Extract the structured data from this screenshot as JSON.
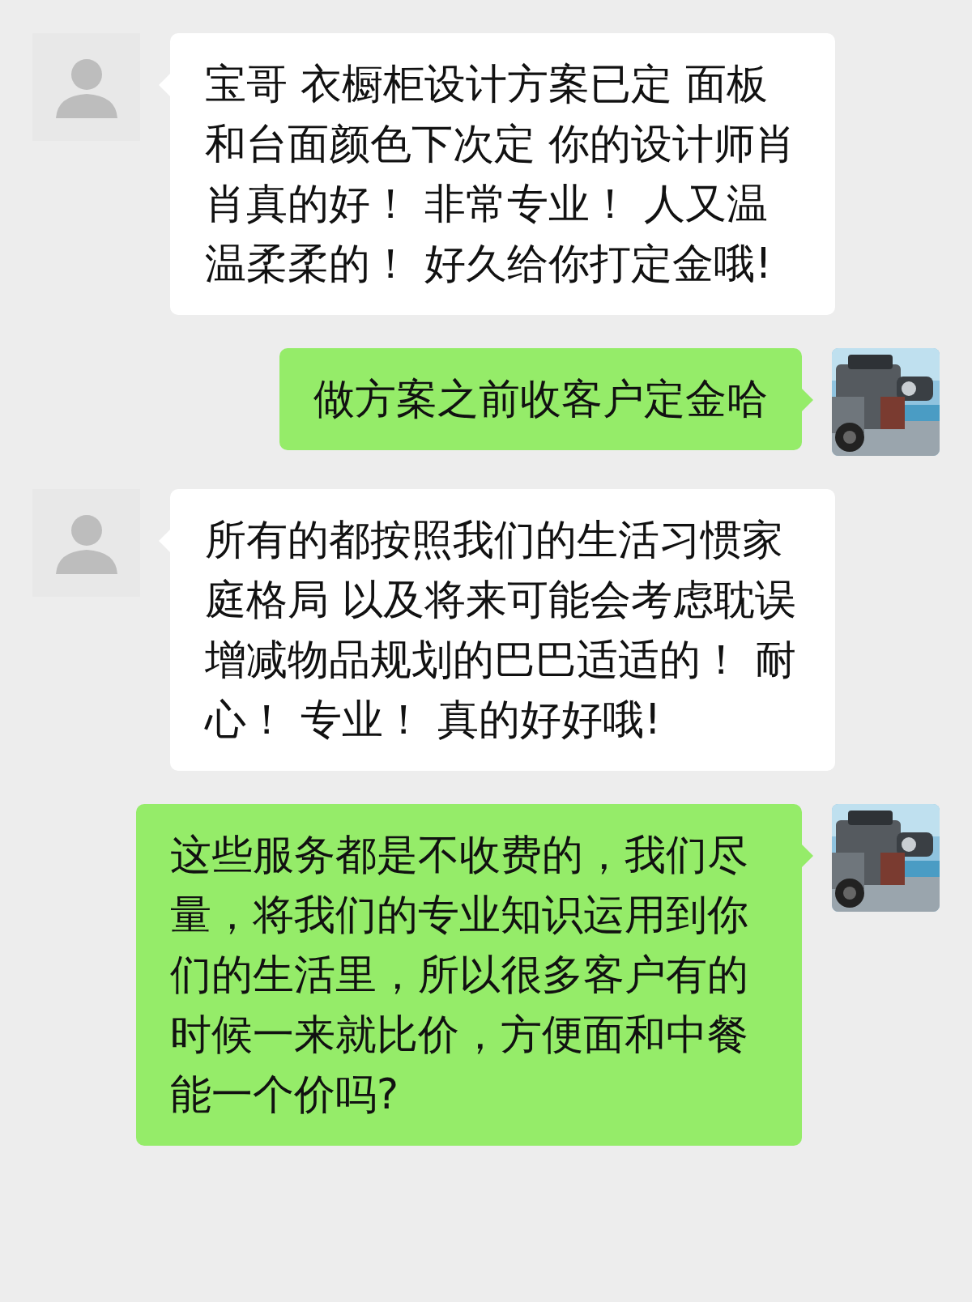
{
  "messages": [
    {
      "kind": "incoming",
      "text": "宝哥 衣橱柜设计方案已定 面板和台面颜色下次定 你的设计师肖肖真的好！ 非常专业！ 人又温温柔柔的！ 好久给你打定金哦!"
    },
    {
      "kind": "outgoing",
      "text": "做方案之前收客户定金哈"
    },
    {
      "kind": "incoming",
      "text": "所有的都按照我们的生活习惯家庭格局 以及将来可能会考虑耽误增减物品规划的巴巴适适的！ 耐心！ 专业！ 真的好好哦!"
    },
    {
      "kind": "outgoing",
      "text": "这些服务都是不收费的，我们尽量，将我们的专业知识运用到你们的生活里，所以很多客户有的时候一来就比价，方便面和中餐能一个价吗?"
    }
  ]
}
